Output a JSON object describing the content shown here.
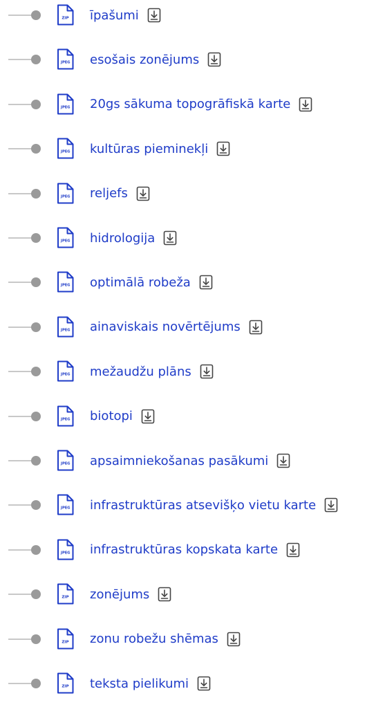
{
  "files": [
    {
      "type": "ZIP",
      "name": "īpašumi"
    },
    {
      "type": "JPEG",
      "name": "esošais zonējums"
    },
    {
      "type": "JPEG",
      "name": "20gs sākuma topogrāfiskā karte"
    },
    {
      "type": "JPEG",
      "name": "kultūras pieminekļi"
    },
    {
      "type": "JPEG",
      "name": "reljefs"
    },
    {
      "type": "JPEG",
      "name": "hidrologija"
    },
    {
      "type": "JPEG",
      "name": "optimālā robeža"
    },
    {
      "type": "JPEG",
      "name": "ainaviskais novērtējums"
    },
    {
      "type": "JPEG",
      "name": "mežaudžu plāns"
    },
    {
      "type": "JPEG",
      "name": "biotopi"
    },
    {
      "type": "JPEG",
      "name": "apsaimniekošanas pasākumi"
    },
    {
      "type": "JPEG",
      "name": "infrastruktūras atsevišķo vietu karte"
    },
    {
      "type": "JPEG",
      "name": "infrastruktūras kopskata karte"
    },
    {
      "type": "ZIP",
      "name": "zonējums"
    },
    {
      "type": "ZIP",
      "name": "zonu robežu shēmas"
    },
    {
      "type": "ZIP",
      "name": "teksta pielikumi"
    }
  ],
  "icons": {
    "file": "file-icon",
    "download": "download-icon",
    "timeline": "timeline-dot"
  },
  "colors": {
    "link": "#1f3cc8",
    "icon": "#1f3cc8",
    "dot": "#9a9a9a",
    "line": "#c8c8c8"
  }
}
